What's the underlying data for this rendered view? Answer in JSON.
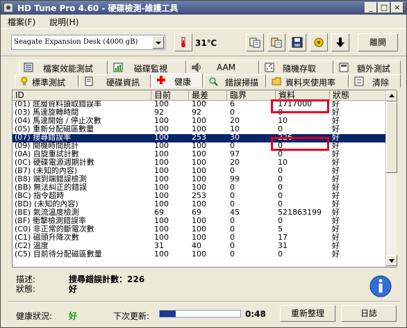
{
  "window": {
    "title": "HD Tune Pro 4.60 - 硬碟檢測-維護工具"
  },
  "menu": {
    "file": "檔案(F)",
    "help": "說明(H)"
  },
  "toolbar": {
    "drive_select": "Seagate Expansion Desk   (4000 gB)",
    "temperature": "31℃",
    "exit_label": "離開"
  },
  "tabs": {
    "row1": [
      "檔案效能測試",
      "磁碟監視",
      "AAM",
      "隨機存取",
      "額外測試"
    ],
    "row2": [
      "標準測試",
      "硬碟資訊",
      "健康",
      "錯誤掃描",
      "資料夾使用率",
      "清除"
    ],
    "active": "健康"
  },
  "table": {
    "headers": [
      "ID",
      "目前",
      "最差",
      "臨界",
      "資料",
      "狀態"
    ],
    "rows": [
      [
        "(01) 底層資料讀取錯誤率",
        "100",
        "100",
        "6",
        "1717000",
        "好"
      ],
      [
        "(03) 馬達旋轉時間",
        "92",
        "92",
        "0",
        "0",
        "好"
      ],
      [
        "(04) 馬達開始 / 停止次數",
        "100",
        "100",
        "20",
        "10",
        "好"
      ],
      [
        "(05) 重新分配磁區數量",
        "100",
        "100",
        "10",
        "0",
        "好"
      ],
      [
        "(07) 搜尋錯誤率",
        "100",
        "253",
        "30",
        "226",
        "好"
      ],
      [
        "(09) 開機時間統計",
        "100",
        "100",
        "0",
        "0",
        "好"
      ],
      [
        "(0A) 自旋重試計數",
        "100",
        "100",
        "97",
        "0",
        "好"
      ],
      [
        "(0C) 硬碟電源週期計數",
        "100",
        "100",
        "20",
        "10",
        "好"
      ],
      [
        "(B7) (未知的內容)",
        "100",
        "100",
        "0",
        "0",
        "好"
      ],
      [
        "(B8) 端到端錯誤檢測",
        "100",
        "100",
        "99",
        "0",
        "好"
      ],
      [
        "(BB) 無法糾正的錯誤",
        "100",
        "100",
        "0",
        "0",
        "好"
      ],
      [
        "(BC) 指令超時",
        "100",
        "253",
        "0",
        "0",
        "好"
      ],
      [
        "(BD) (未知的內容)",
        "100",
        "100",
        "0",
        "0",
        "好"
      ],
      [
        "(BE) 氣流溫度檢測",
        "69",
        "69",
        "45",
        "521863199",
        "好"
      ],
      [
        "(BF) 衝擊檢測錯誤率",
        "100",
        "100",
        "0",
        "0",
        "好"
      ],
      [
        "(C0) 非正常的斷電次數",
        "100",
        "100",
        "0",
        "5",
        "好"
      ],
      [
        "(C1) 磁頭升降次數",
        "100",
        "100",
        "0",
        "17",
        "好"
      ],
      [
        "(C2) 溫度",
        "31",
        "40",
        "0",
        "31",
        "好"
      ],
      [
        "(C5) 目前待分配磁區數量",
        "100",
        "100",
        "0",
        "0",
        "好"
      ]
    ],
    "selected_index": 4
  },
  "details": {
    "desc_label": "描述:",
    "desc_value": "搜尋錯誤計數：226",
    "status_label": "狀態:",
    "status_value": "好"
  },
  "footer": {
    "health_label": "健康狀況:",
    "health_value": "好",
    "next_update_label": "下次更新:",
    "next_update_value": "0:48",
    "update_progress": 0.2,
    "refresh_button": "重新整理",
    "log_button": "日誌"
  },
  "colors": {
    "highlight_box": "#e00020",
    "selection": "#0a246a",
    "health_good": "#1aa01a"
  },
  "icons": [
    "hdd-app-icon",
    "thermometer-icon",
    "copy-icon",
    "copy-info-icon",
    "save-icon",
    "options-icon",
    "down-arrow-icon",
    "info-icon"
  ]
}
